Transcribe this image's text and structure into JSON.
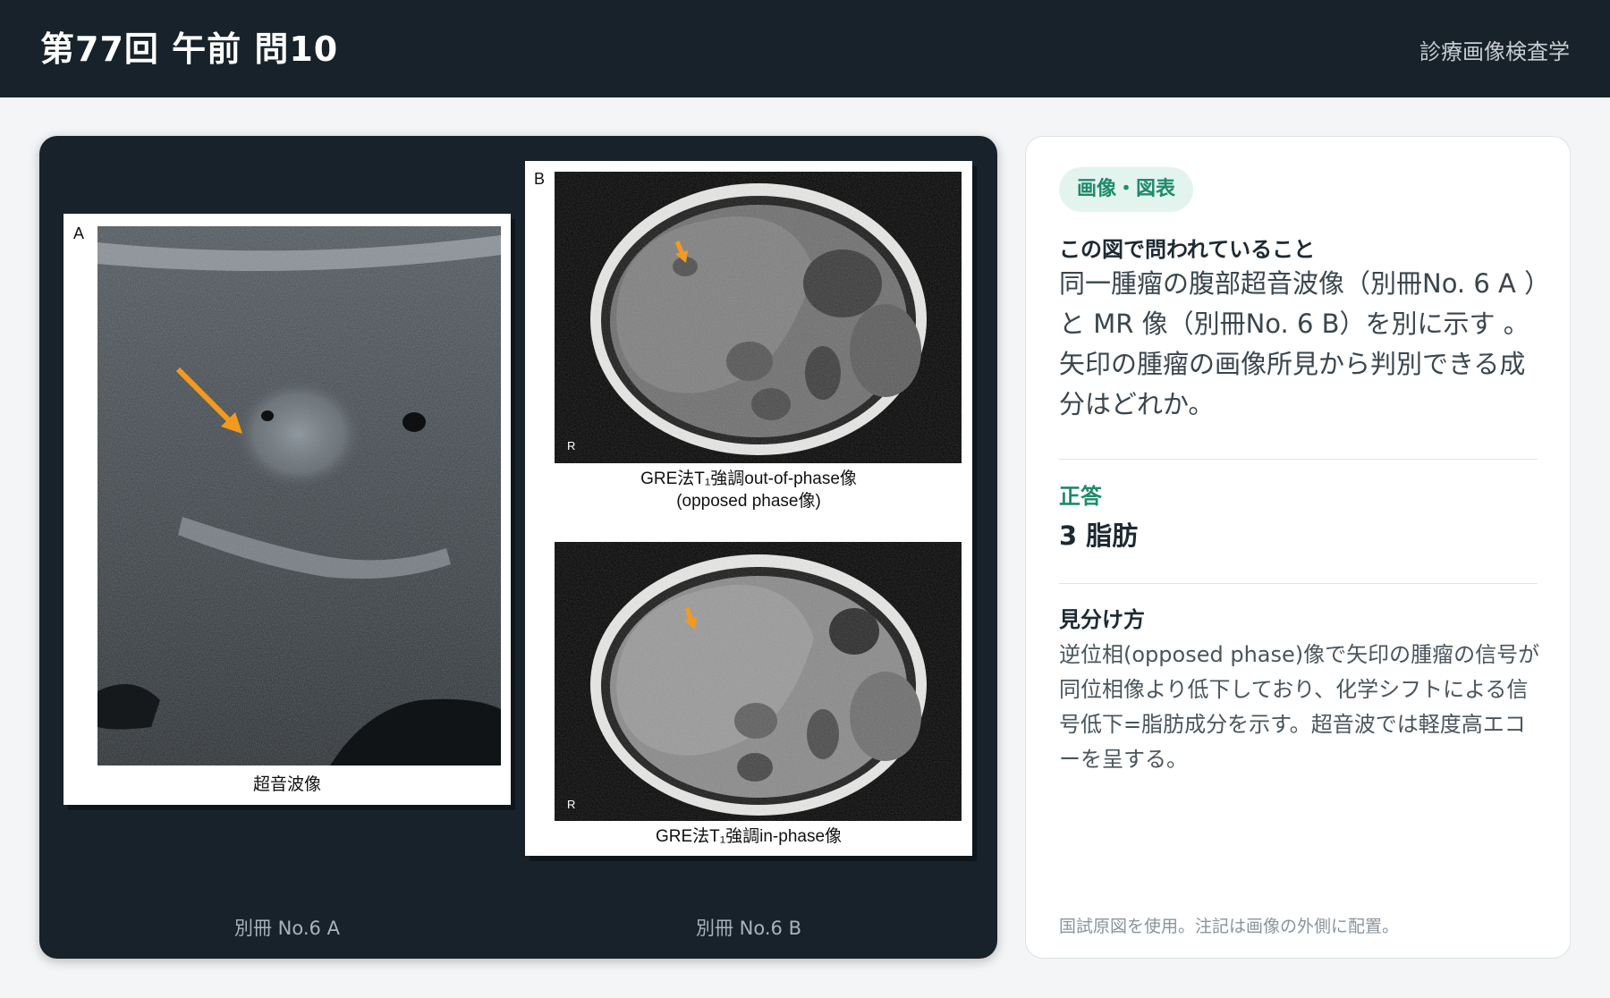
{
  "header": {
    "title": "第77回 午前 問10",
    "subject": "診療画像検査学"
  },
  "figure": {
    "card_a_letter": "A",
    "card_a_caption": "超音波像",
    "card_b_letter": "B",
    "mr_top_caption_line1": "GRE法T₁強調out-of-phase像",
    "mr_top_caption_line2": "(opposed phase像)",
    "mr_bottom_caption": "GRE法T₁強調in-phase像",
    "r_marker": "R",
    "label_a": "別冊 No.6 A",
    "label_b": "別冊 No.6 B",
    "arrow_color": "#f39a1e"
  },
  "info": {
    "tag": "画像・図表",
    "question_heading": "この図で問われていること",
    "question_text": "同一腫瘤の腹部超音波像（別冊No. 6 A ）と MR 像（別冊No. 6 B）を別に示す 。 矢印の腫瘤の画像所見から判別できる成分はどれか。",
    "answer_heading": "正答",
    "answer_text": "3 脂肪",
    "tips_heading": "見分け方",
    "tips_text": "逆位相(opposed phase)像で矢印の腫瘤の信号が同位相像より低下しており、化学シフトによる信号低下=脂肪成分を示す。超音波では軽度高エコーを呈する。",
    "footnote": "国試原図を使用。注記は画像の外側に配置。"
  },
  "colors": {
    "header_bg": "#17222a",
    "accent": "#1f8a6a",
    "tag_bg": "#e3f4ef"
  }
}
